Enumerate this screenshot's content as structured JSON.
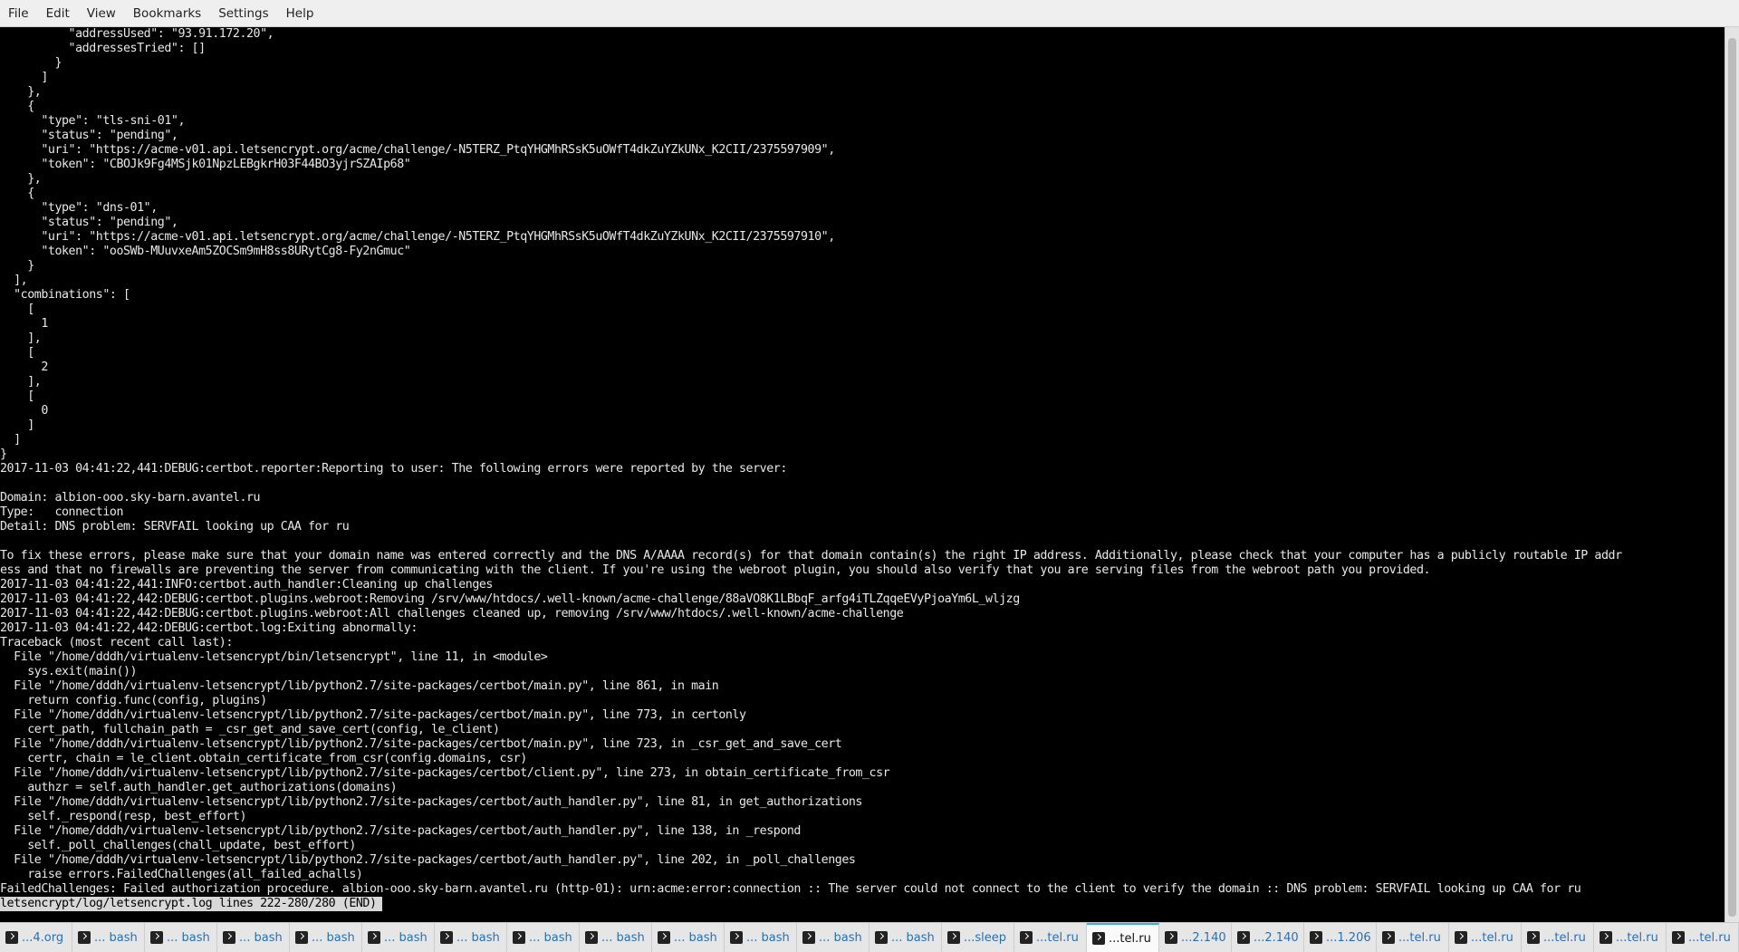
{
  "menubar": {
    "items": [
      "File",
      "Edit",
      "View",
      "Bookmarks",
      "Settings",
      "Help"
    ]
  },
  "terminal": {
    "lines": [
      "          \"addressUsed\": \"93.91.172.20\",",
      "          \"addressesTried\": []",
      "        }",
      "      ]",
      "    },",
      "    {",
      "      \"type\": \"tls-sni-01\",",
      "      \"status\": \"pending\",",
      "      \"uri\": \"https://acme-v01.api.letsencrypt.org/acme/challenge/-N5TERZ_PtqYHGMhRSsK5uOWfT4dkZuYZkUNx_K2CII/2375597909\",",
      "      \"token\": \"CBOJk9Fg4MSjk01NpzLEBgkrH03F44BO3yjrSZAIp68\"",
      "    },",
      "    {",
      "      \"type\": \"dns-01\",",
      "      \"status\": \"pending\",",
      "      \"uri\": \"https://acme-v01.api.letsencrypt.org/acme/challenge/-N5TERZ_PtqYHGMhRSsK5uOWfT4dkZuYZkUNx_K2CII/2375597910\",",
      "      \"token\": \"ooSWb-MUuvxeAm5ZOCSm9mH8ss8URytCg8-Fy2nGmuc\"",
      "    }",
      "  ],",
      "  \"combinations\": [",
      "    [",
      "      1",
      "    ],",
      "    [",
      "      2",
      "    ],",
      "    [",
      "      0",
      "    ]",
      "  ]",
      "}",
      "2017-11-03 04:41:22,441:DEBUG:certbot.reporter:Reporting to user: The following errors were reported by the server:",
      "",
      "Domain: albion-ooo.sky-barn.avantel.ru",
      "Type:   connection",
      "Detail: DNS problem: SERVFAIL looking up CAA for ru",
      "",
      "To fix these errors, please make sure that your domain name was entered correctly and the DNS A/AAAA record(s) for that domain contain(s) the right IP address. Additionally, please check that your computer has a publicly routable IP addr",
      "ess and that no firewalls are preventing the server from communicating with the client. If you're using the webroot plugin, you should also verify that you are serving files from the webroot path you provided.",
      "2017-11-03 04:41:22,441:INFO:certbot.auth_handler:Cleaning up challenges",
      "2017-11-03 04:41:22,442:DEBUG:certbot.plugins.webroot:Removing /srv/www/htdocs/.well-known/acme-challenge/88aVO8K1LBbqF_arfg4iTLZqqeEVyPjoaYm6L_wljzg",
      "2017-11-03 04:41:22,442:DEBUG:certbot.plugins.webroot:All challenges cleaned up, removing /srv/www/htdocs/.well-known/acme-challenge",
      "2017-11-03 04:41:22,442:DEBUG:certbot.log:Exiting abnormally:",
      "Traceback (most recent call last):",
      "  File \"/home/dddh/virtualenv-letsencrypt/bin/letsencrypt\", line 11, in <module>",
      "    sys.exit(main())",
      "  File \"/home/dddh/virtualenv-letsencrypt/lib/python2.7/site-packages/certbot/main.py\", line 861, in main",
      "    return config.func(config, plugins)",
      "  File \"/home/dddh/virtualenv-letsencrypt/lib/python2.7/site-packages/certbot/main.py\", line 773, in certonly",
      "    cert_path, fullchain_path = _csr_get_and_save_cert(config, le_client)",
      "  File \"/home/dddh/virtualenv-letsencrypt/lib/python2.7/site-packages/certbot/main.py\", line 723, in _csr_get_and_save_cert",
      "    certr, chain = le_client.obtain_certificate_from_csr(config.domains, csr)",
      "  File \"/home/dddh/virtualenv-letsencrypt/lib/python2.7/site-packages/certbot/client.py\", line 273, in obtain_certificate_from_csr",
      "    authzr = self.auth_handler.get_authorizations(domains)",
      "  File \"/home/dddh/virtualenv-letsencrypt/lib/python2.7/site-packages/certbot/auth_handler.py\", line 81, in get_authorizations",
      "    self._respond(resp, best_effort)",
      "  File \"/home/dddh/virtualenv-letsencrypt/lib/python2.7/site-packages/certbot/auth_handler.py\", line 138, in _respond",
      "    self._poll_challenges(chall_update, best_effort)",
      "  File \"/home/dddh/virtualenv-letsencrypt/lib/python2.7/site-packages/certbot/auth_handler.py\", line 202, in _poll_challenges",
      "    raise errors.FailedChallenges(all_failed_achalls)",
      "FailedChallenges: Failed authorization procedure. albion-ooo.sky-barn.avantel.ru (http-01): urn:acme:error:connection :: The server could not connect to the client to verify the domain :: DNS problem: SERVFAIL looking up CAA for ru"
    ],
    "status_line": "letsencrypt/log/letsencrypt.log lines 222-280/280 (END)"
  },
  "tabs": [
    {
      "label": "...4.org",
      "active": false
    },
    {
      "label": "... bash",
      "active": false
    },
    {
      "label": "... bash",
      "active": false
    },
    {
      "label": "... bash",
      "active": false
    },
    {
      "label": "... bash",
      "active": false
    },
    {
      "label": "... bash",
      "active": false
    },
    {
      "label": "... bash",
      "active": false
    },
    {
      "label": "... bash",
      "active": false
    },
    {
      "label": "... bash",
      "active": false
    },
    {
      "label": "... bash",
      "active": false
    },
    {
      "label": "... bash",
      "active": false
    },
    {
      "label": "... bash",
      "active": false
    },
    {
      "label": "... bash",
      "active": false
    },
    {
      "label": "...sleep",
      "active": false
    },
    {
      "label": "...tel.ru",
      "active": false
    },
    {
      "label": "...tel.ru",
      "active": true
    },
    {
      "label": "...2.140",
      "active": false
    },
    {
      "label": "...2.140",
      "active": false
    },
    {
      "label": "...1.206",
      "active": false
    },
    {
      "label": "...tel.ru",
      "active": false
    },
    {
      "label": "...tel.ru",
      "active": false
    },
    {
      "label": "...tel.ru",
      "active": false
    },
    {
      "label": "...tel.ru",
      "active": false
    },
    {
      "label": "...tel.ru",
      "active": false
    }
  ],
  "colors": {
    "terminal_background": "#000000",
    "terminal_foreground": "#e8e8e8",
    "active_tab_accent": "#3daee9",
    "inactive_tab_text": "#2a6fb0"
  }
}
